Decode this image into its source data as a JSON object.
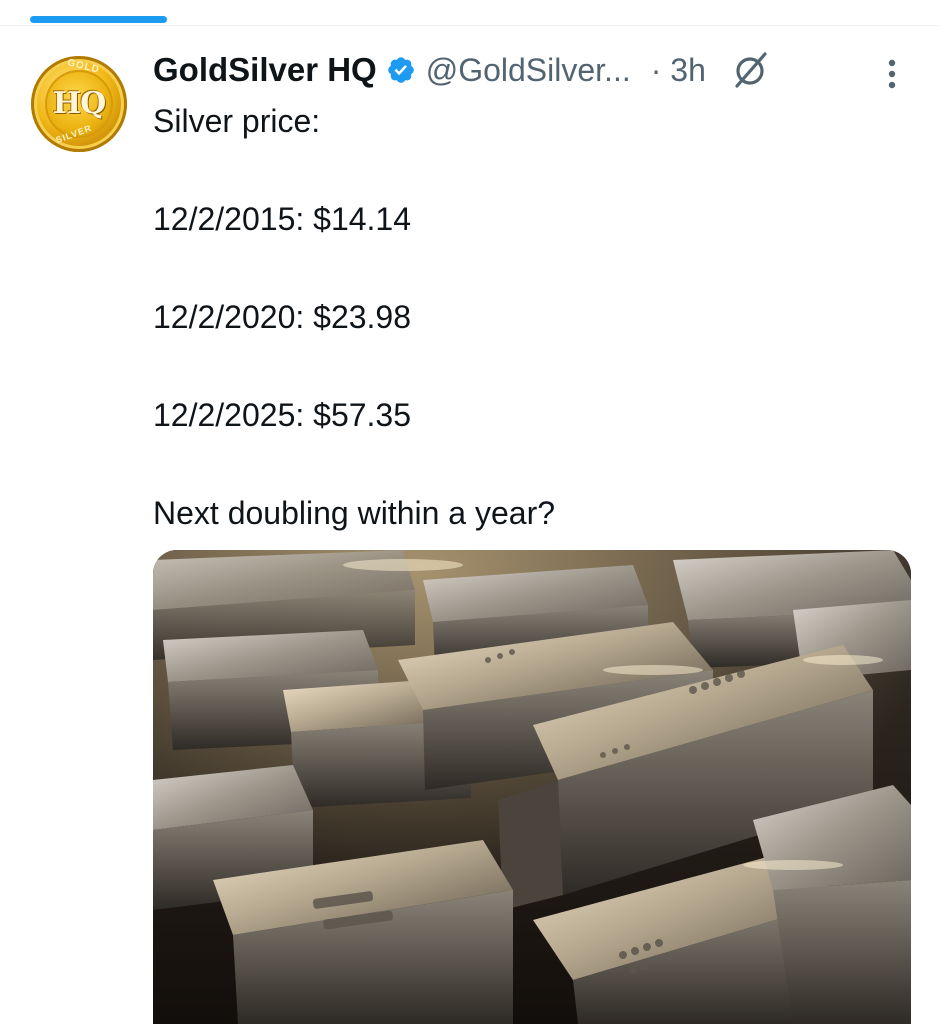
{
  "tweet": {
    "author": {
      "display_name": "GoldSilver HQ",
      "handle": "@GoldSilver...",
      "verified": true,
      "avatar_text": "HQ",
      "avatar_top_text": "GOLD",
      "avatar_bottom_text": "SILVER"
    },
    "timestamp": "· 3h",
    "icons": {
      "verified": "verified-badge-icon",
      "grok": "grok-icon",
      "more": "more-vertical-icon"
    },
    "text": {
      "line1": "Silver price:",
      "line2": "12/2/2015: $14.14",
      "line3": "12/2/2020: $23.98",
      "line4": "12/2/2025: $57.35",
      "line5": "Next doubling within a year?"
    },
    "media": {
      "type": "image",
      "subject": "stacked silver bars"
    }
  },
  "colors": {
    "accent": "#1d9bf0",
    "text_primary": "#0f1419",
    "text_secondary": "#536471"
  }
}
